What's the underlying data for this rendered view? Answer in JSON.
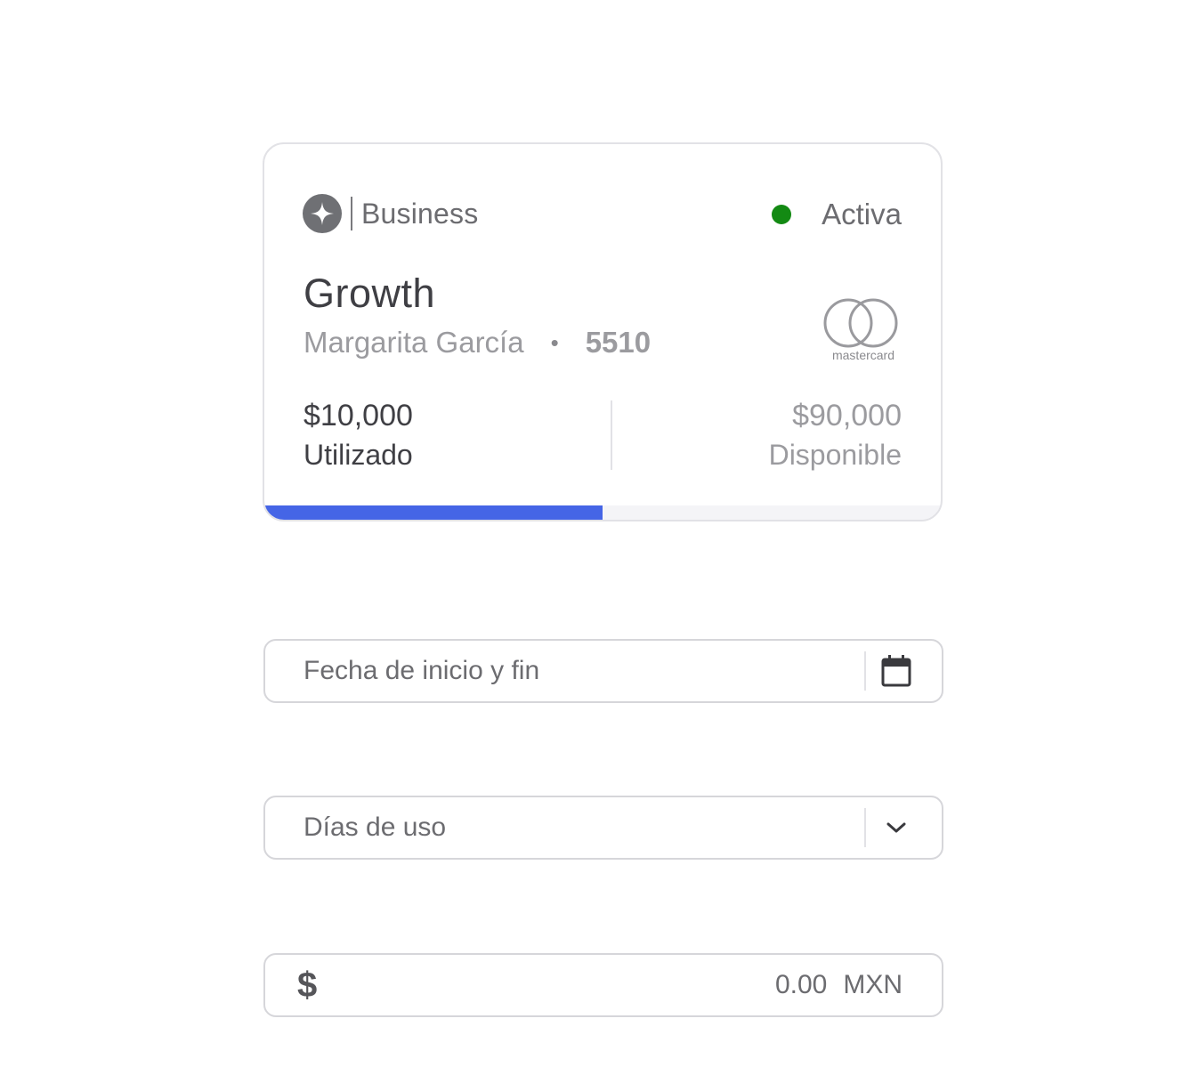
{
  "card": {
    "brand_name": "Business",
    "status": {
      "label": "Activa",
      "color": "#138a13"
    },
    "title": "Growth",
    "holder_name": "Margarita García",
    "separator": "•",
    "last4": "5510",
    "network": "mastercard",
    "used": {
      "amount": "$10,000",
      "label": "Utilizado"
    },
    "available": {
      "amount": "$90,000",
      "label": "Disponible"
    },
    "progress": {
      "percent": 50,
      "color": "#4565e6"
    }
  },
  "date_field": {
    "placeholder": "Fecha de inicio y fin",
    "icon": "calendar-icon"
  },
  "days_field": {
    "placeholder": "Días de uso",
    "icon": "chevron-down-icon"
  },
  "amount_field": {
    "symbol": "$",
    "value": "0.00",
    "currency": "MXN"
  }
}
